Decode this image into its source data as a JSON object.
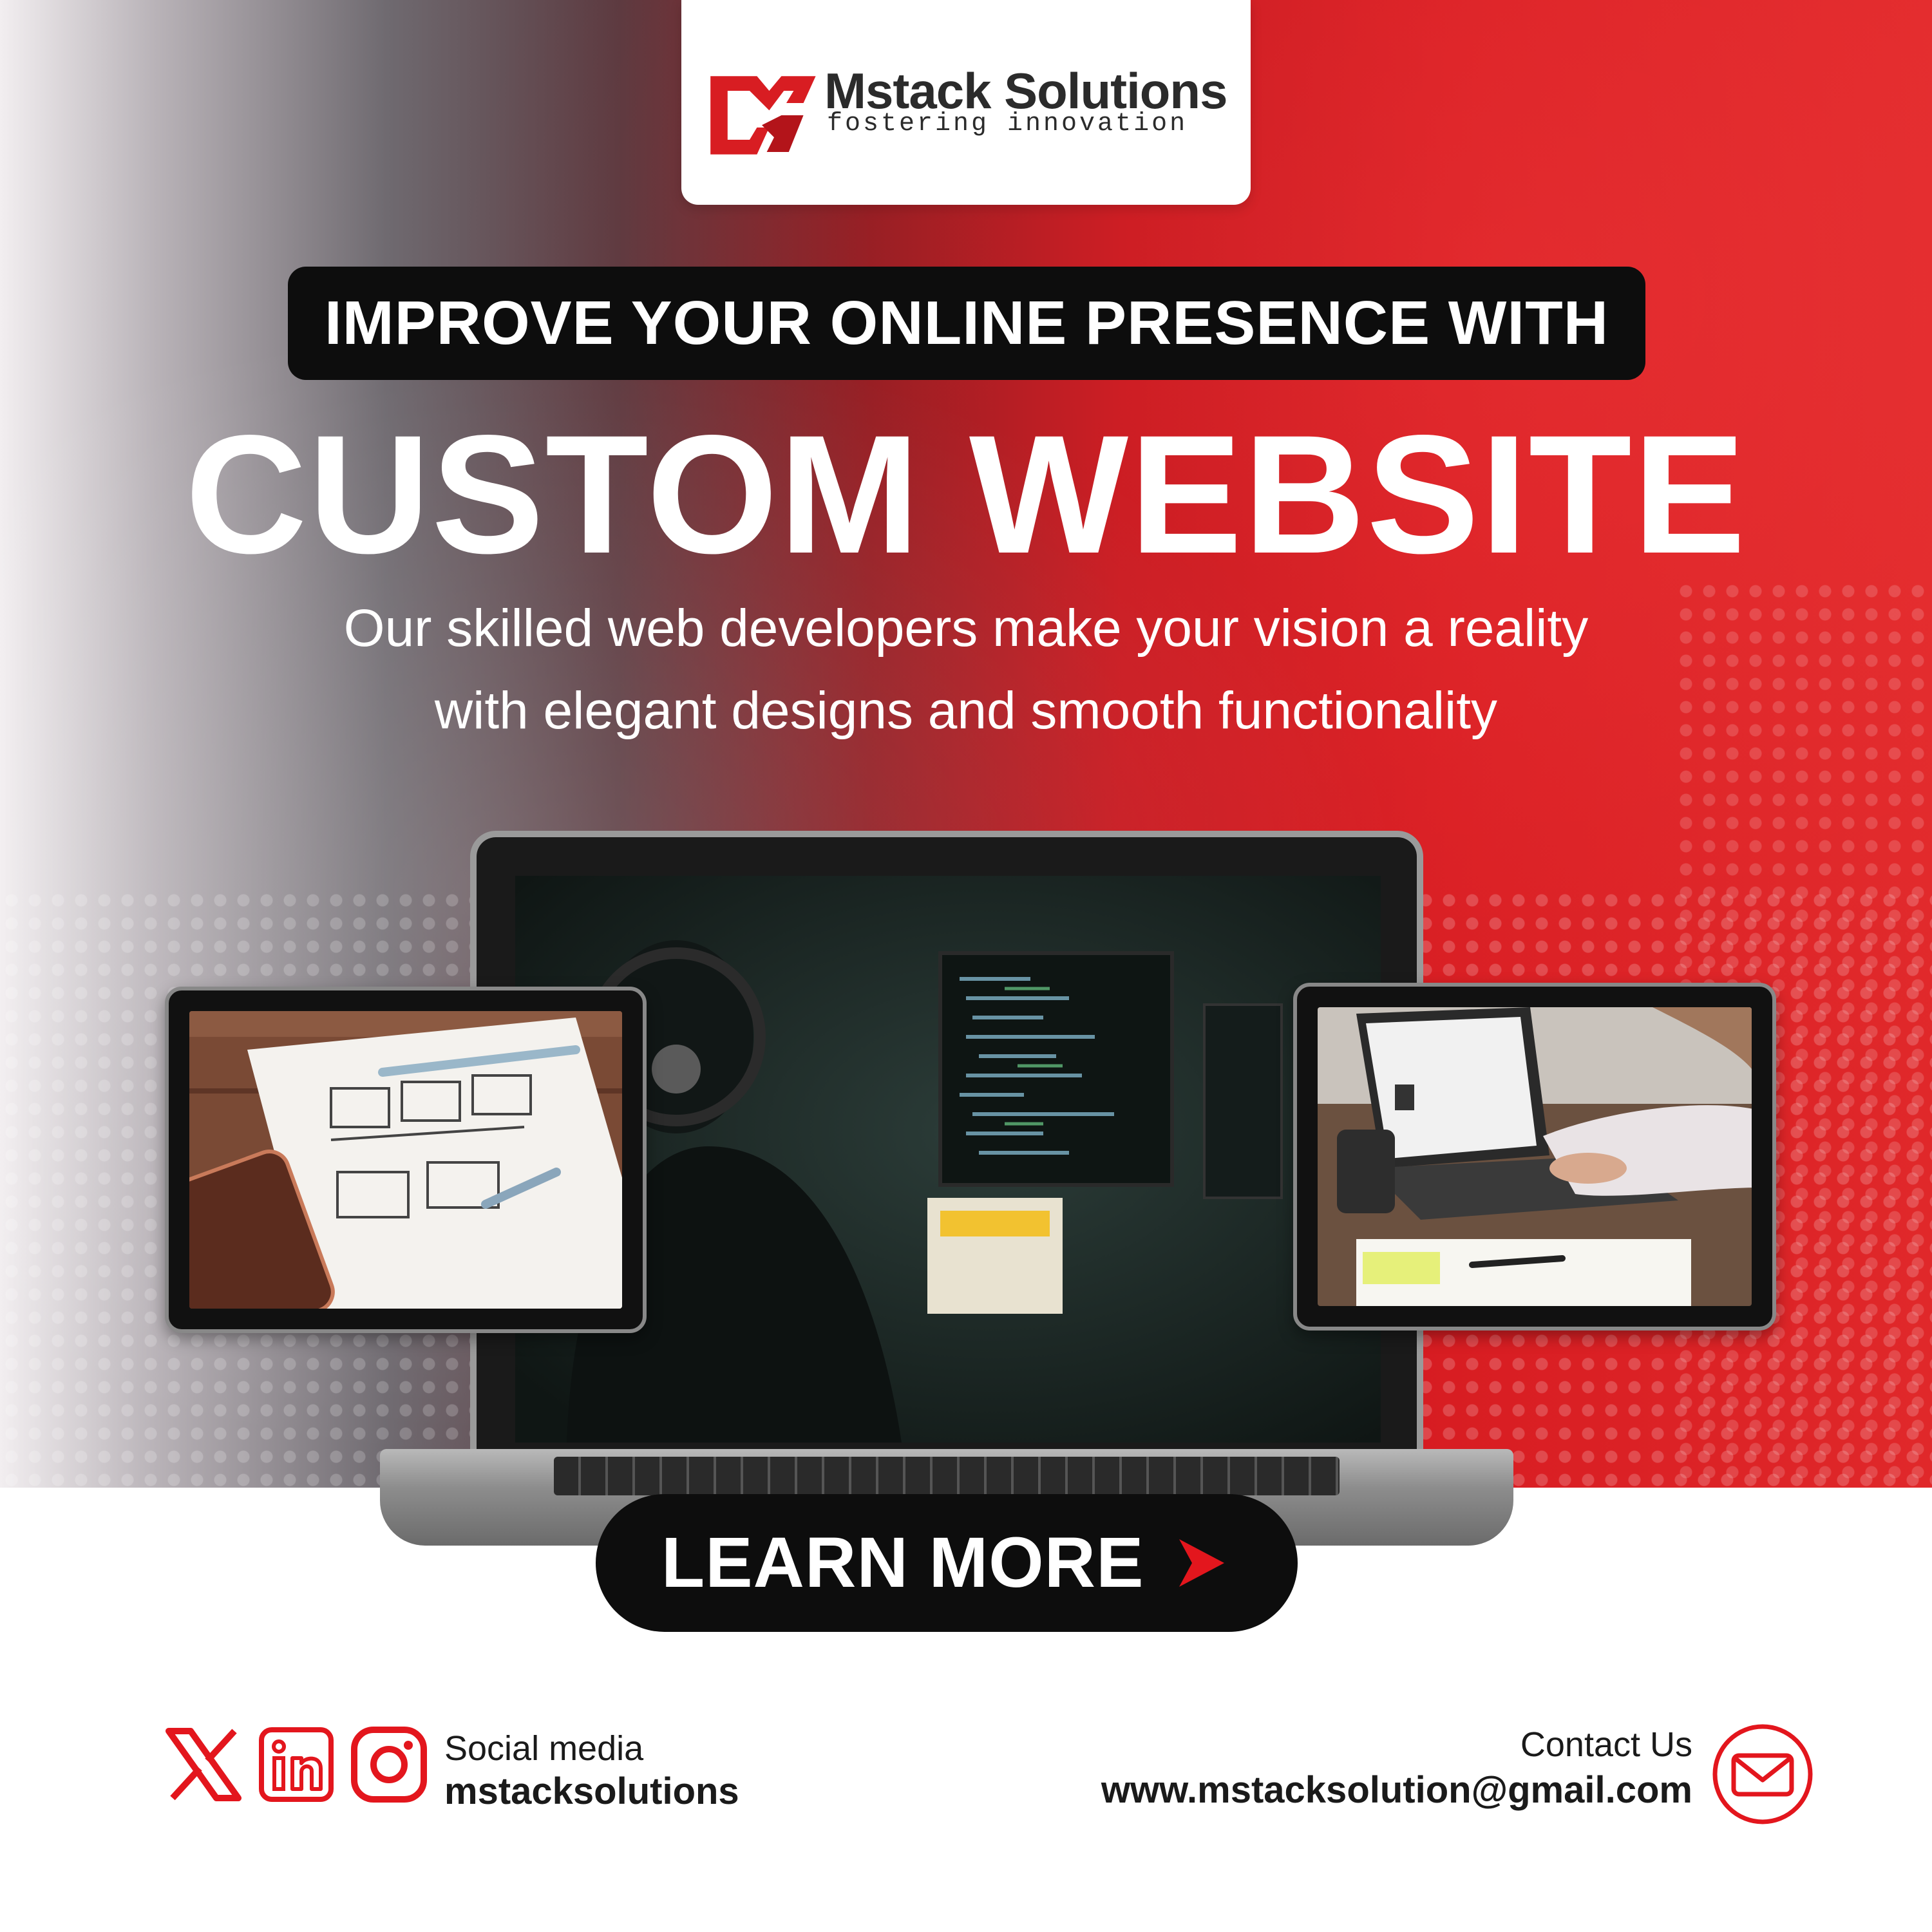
{
  "brand": {
    "name": "Mstack Solutions",
    "tagline": "fostering innovation"
  },
  "banner": "IMPROVE YOUR ONLINE PRESENCE WITH",
  "headline": "CUSTOM WEBSITE",
  "subtext": {
    "line1": "Our skilled web developers make your vision a reality",
    "line2": "with elegant designs and smooth functionality"
  },
  "cta": {
    "label": "LEARN MORE"
  },
  "footer": {
    "social_label": "Social media",
    "social_handle": "mstacksolutions",
    "contact_label": "Contact Us",
    "contact_email": "www.mstacksolution@gmail.com"
  },
  "icons": {
    "x": "x-logo-icon",
    "linkedin": "linkedin-icon",
    "instagram": "instagram-icon",
    "mail": "mail-icon",
    "arrow": "chevron-right-icon"
  },
  "colors": {
    "brand_red": "#d81d22",
    "dark": "#0d0d0d",
    "icon_red": "#e3161d"
  }
}
